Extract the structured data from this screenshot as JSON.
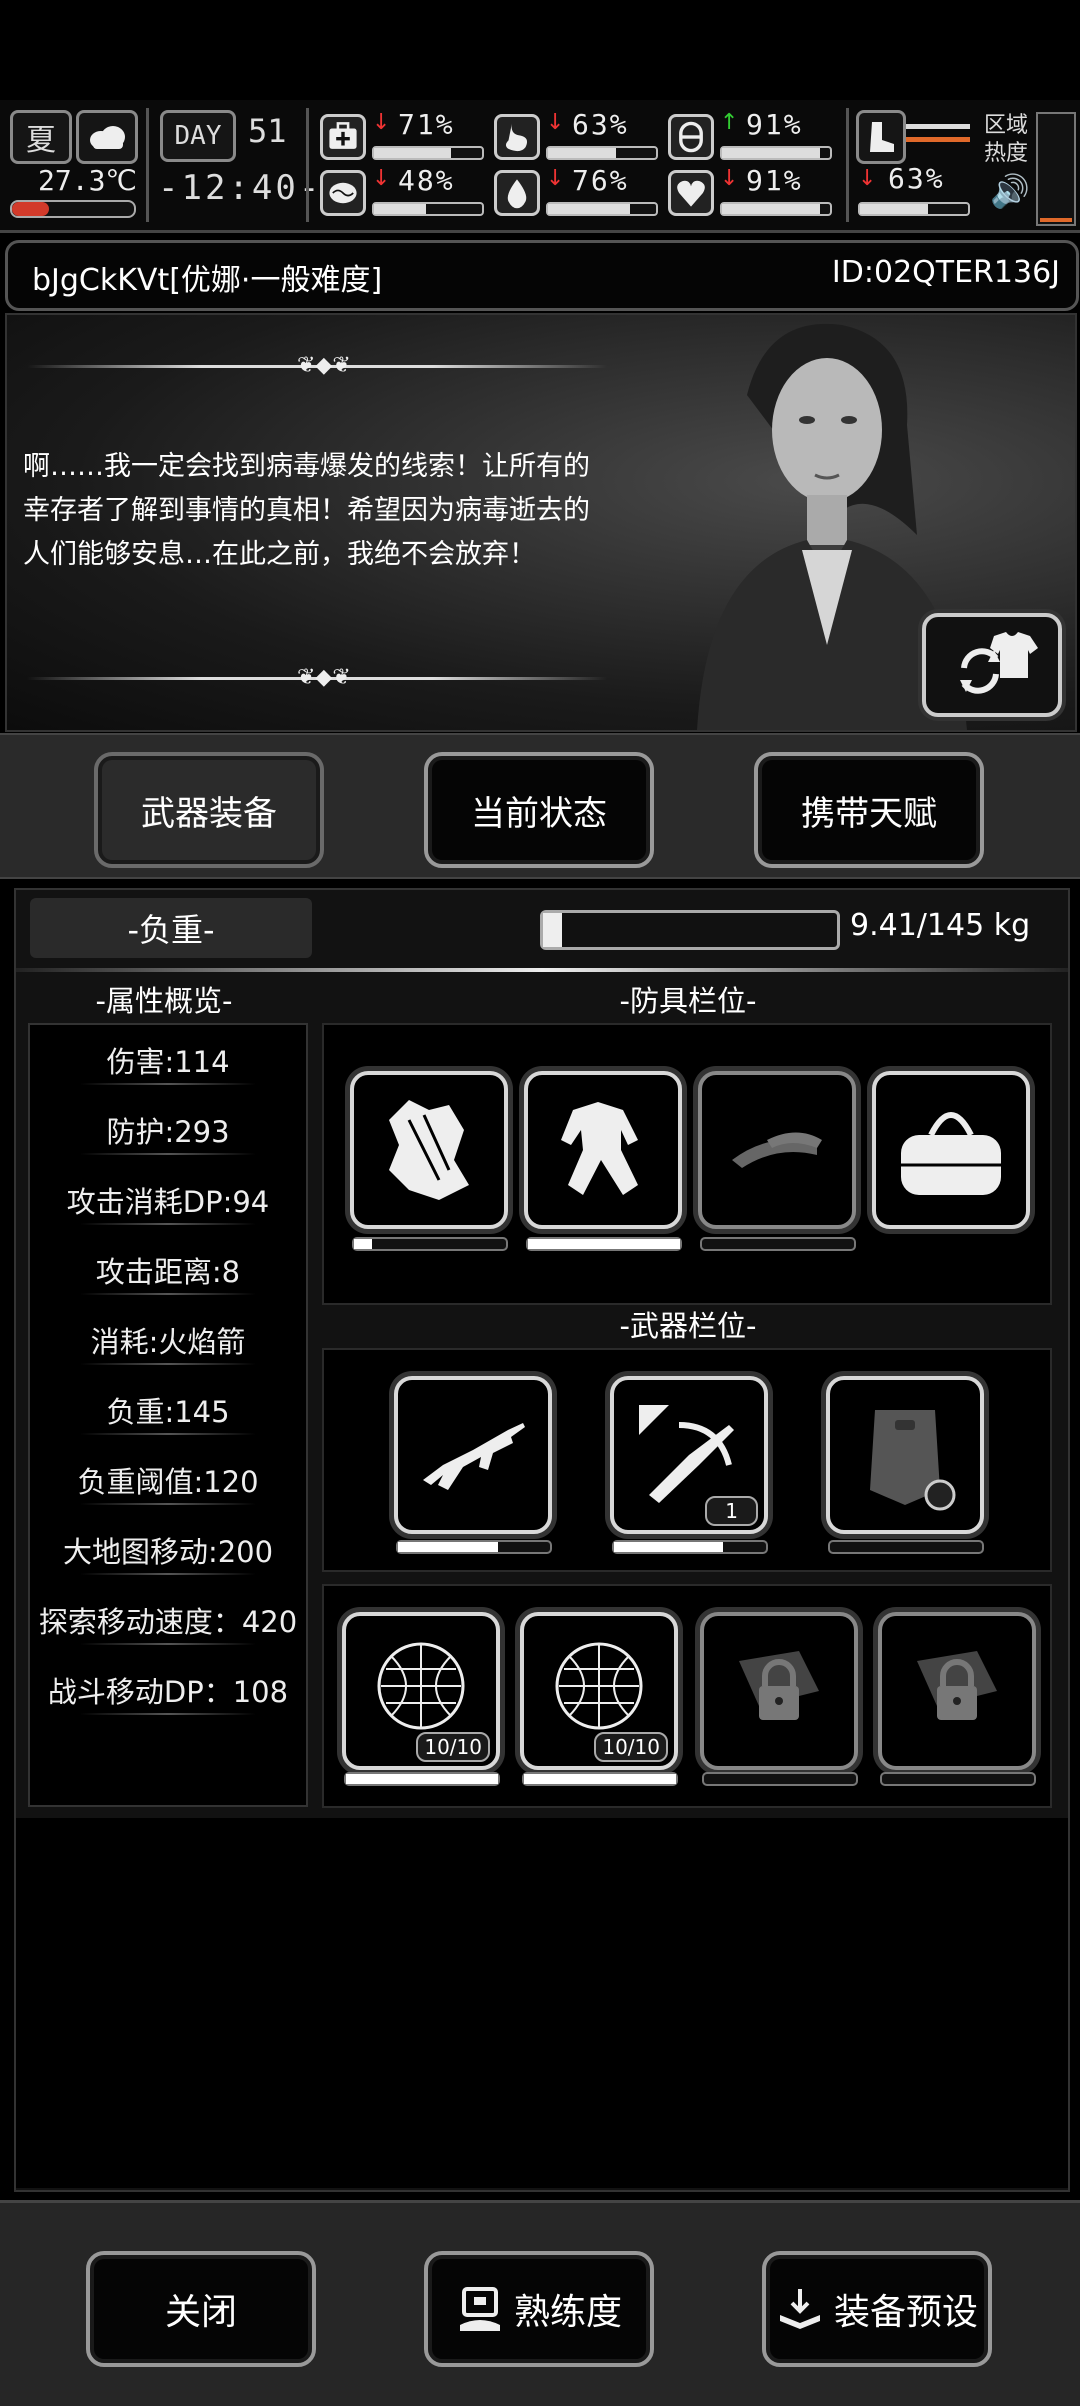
{
  "hud": {
    "season": "夏",
    "temperature": "27.3℃",
    "day_label": "DAY",
    "day_number": "51",
    "clock": "-12:40-",
    "stats": [
      {
        "icon": "medkit-icon",
        "trend": "down",
        "value": "71%",
        "level": 0.71
      },
      {
        "icon": "stomach-icon",
        "trend": "down",
        "value": "63%",
        "level": 0.63
      },
      {
        "icon": "pill-icon",
        "trend": "up",
        "value": "91%",
        "level": 0.91
      },
      {
        "icon": "brain-icon",
        "trend": "down",
        "value": "48%",
        "level": 0.48
      },
      {
        "icon": "water-drop-icon",
        "trend": "down",
        "value": "76%",
        "level": 0.76
      },
      {
        "icon": "heart-icon",
        "trend": "down",
        "value": "91%",
        "level": 0.91
      }
    ],
    "boot": {
      "trend": "down",
      "value": "63%",
      "level": 0.63
    },
    "zone_heat_label_1": "区域",
    "zone_heat_label_2": "热度"
  },
  "title": {
    "character": "bJgCkKVt[优娜·一般难度]",
    "id": "ID:02QTER136J"
  },
  "dialogue": "啊……我一定会找到病毒爆发的线索！让所有的幸存者了解到事情的真相！希望因为病毒逝去的人们能够安息…在此之前，我绝不会放弃！",
  "tabs": [
    {
      "label": "武器装备",
      "active": true
    },
    {
      "label": "当前状态",
      "active": false
    },
    {
      "label": "携带天赋",
      "active": false
    }
  ],
  "load": {
    "label": "-负重-",
    "value": "9.41/145 kg",
    "fraction": 0.065
  },
  "attributes": {
    "heading": "-属性概览-",
    "items": [
      "伤害:114",
      "防护:293",
      "攻击消耗DP:94",
      "攻击距离:8",
      "消耗:火焰箭",
      "负重:145",
      "负重阈值:120",
      "大地图移动:200",
      "探索移动速度：420",
      "战斗移动DP：108"
    ]
  },
  "armor": {
    "heading": "-防具栏位-",
    "slots": [
      {
        "icon": "cloth-scraps-icon",
        "durability": 0.12
      },
      {
        "icon": "jumpsuit-icon",
        "durability": 1.0
      },
      {
        "icon": "visor-cap-icon",
        "durability": 0
      },
      {
        "icon": "duffel-bag-icon",
        "durability": null
      }
    ]
  },
  "weapons": {
    "heading": "-武器栏位-",
    "slots": [
      {
        "icon": "assault-rifle-icon",
        "durability": 0.66
      },
      {
        "icon": "crossbow-icon",
        "durability": 0.72,
        "ammo": "1"
      },
      {
        "icon": "riot-shield-icon",
        "durability": 0
      }
    ]
  },
  "traps": [
    {
      "icon": "net-trap-icon",
      "count": "10/10",
      "durability": 1.0
    },
    {
      "icon": "net-trap-icon",
      "count": "10/10",
      "durability": 1.0
    },
    {
      "icon": "locked-slot-icon",
      "durability": 0
    },
    {
      "icon": "locked-slot-icon",
      "durability": 0
    }
  ],
  "footer": {
    "close": "关闭",
    "proficiency": "熟练度",
    "preset": "装备预设"
  }
}
